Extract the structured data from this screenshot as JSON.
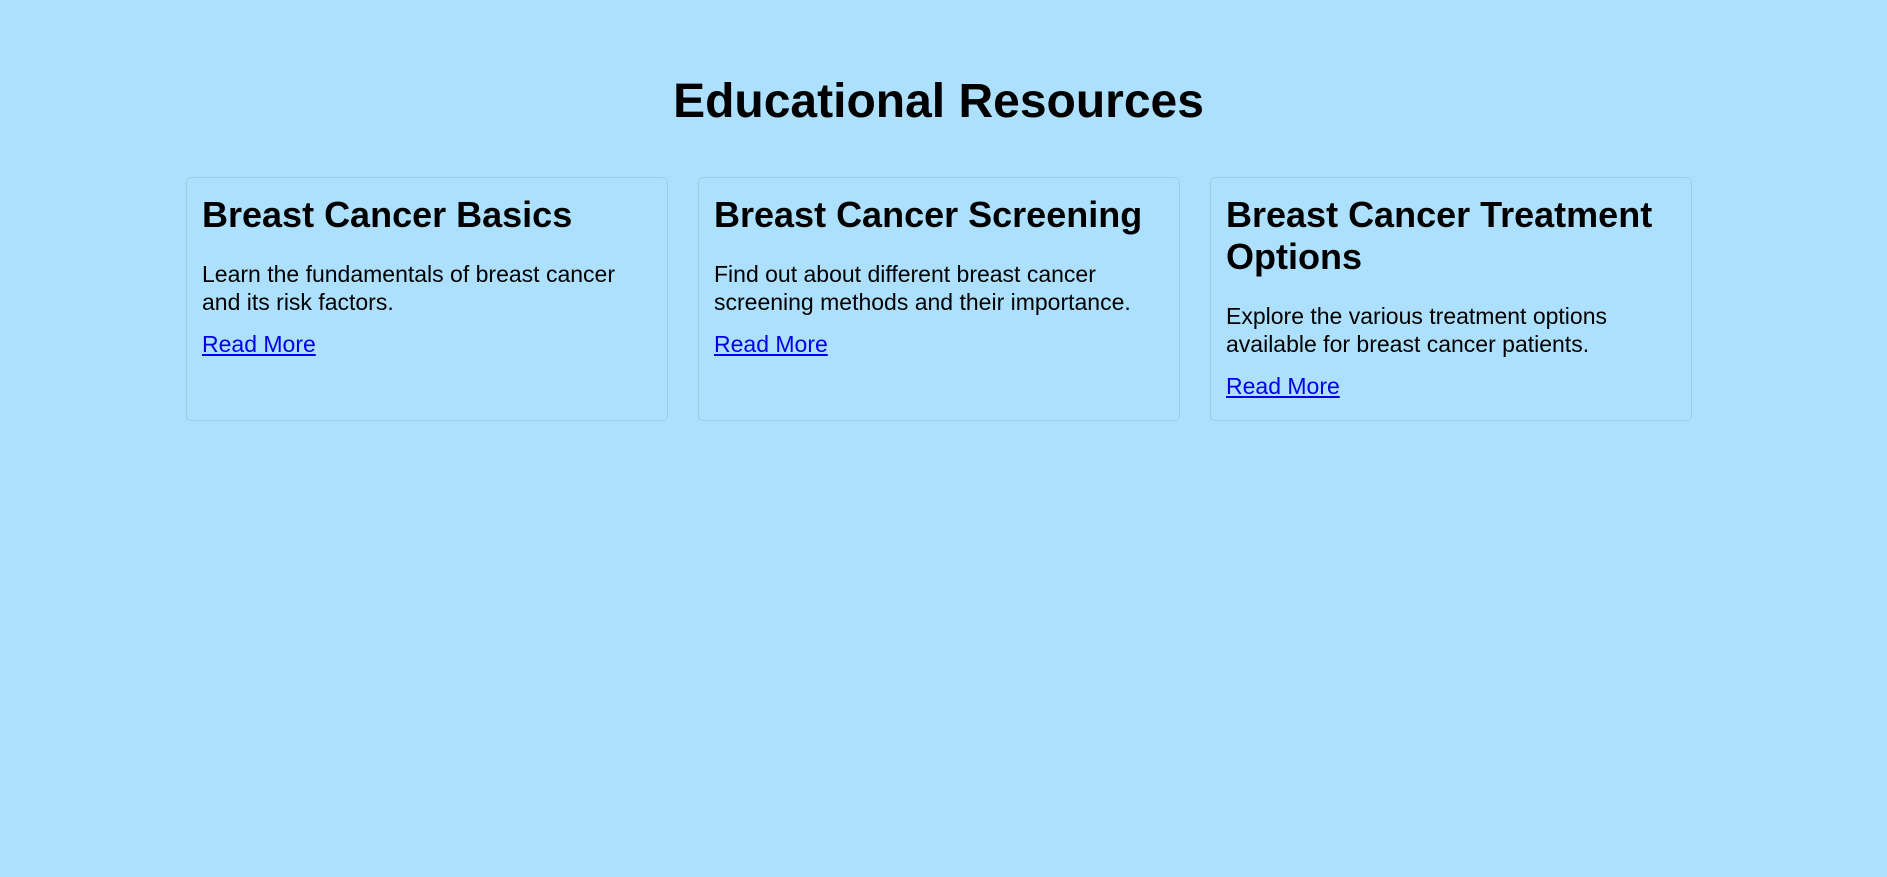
{
  "page": {
    "title": "Educational Resources"
  },
  "cards": [
    {
      "title": "Breast Cancer Basics",
      "description": "Learn the fundamentals of breast cancer and its risk factors.",
      "link_label": "Read More"
    },
    {
      "title": "Breast Cancer Screening",
      "description": "Find out about different breast cancer screening methods and their importance.",
      "link_label": "Read More"
    },
    {
      "title": "Breast Cancer Treatment Options",
      "description": "Explore the various treatment options available for breast cancer patients.",
      "link_label": "Read More"
    }
  ],
  "colors": {
    "background": "#ade0fd",
    "link": "#0000ee",
    "text": "#000000"
  }
}
